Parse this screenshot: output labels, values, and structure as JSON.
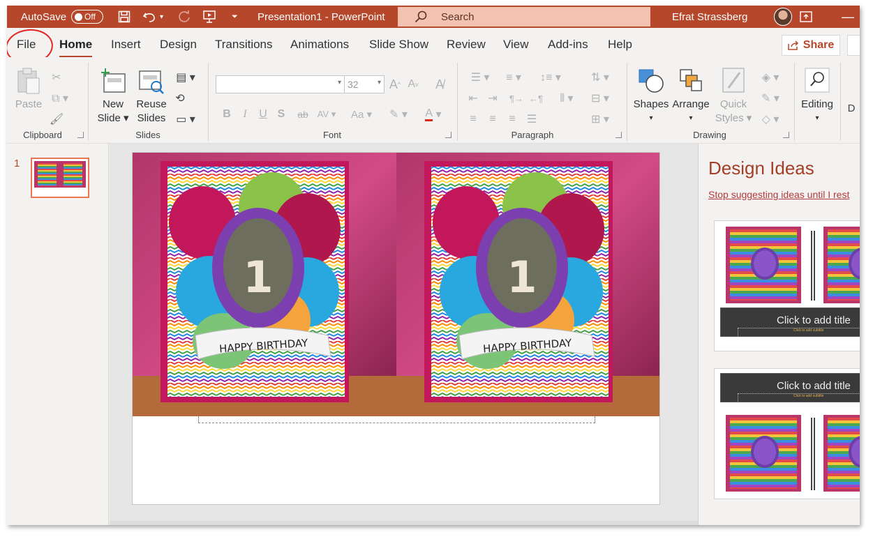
{
  "titlebar": {
    "autosave_label": "AutoSave",
    "autosave_state": "Off",
    "doc_title": "Presentation1 - PowerPoint",
    "search_placeholder": "Search",
    "user_name": "Efrat Strassberg"
  },
  "tabs": [
    "File",
    "Home",
    "Insert",
    "Design",
    "Transitions",
    "Animations",
    "Slide Show",
    "Review",
    "View",
    "Add-ins",
    "Help"
  ],
  "active_tab": "Home",
  "share_label": "Share",
  "ribbon": {
    "clipboard": {
      "label": "Clipboard",
      "paste": "Paste"
    },
    "slides": {
      "label": "Slides",
      "new_slide_1": "New",
      "new_slide_2": "Slide",
      "reuse_1": "Reuse",
      "reuse_2": "Slides"
    },
    "font": {
      "label": "Font",
      "size": "32"
    },
    "paragraph": {
      "label": "Paragraph"
    },
    "drawing": {
      "label": "Drawing",
      "shapes": "Shapes",
      "arrange": "Arrange",
      "quick_styles_1": "Quick",
      "quick_styles_2": "Styles"
    },
    "editing": {
      "label": "Editing"
    }
  },
  "thumbnails": {
    "slide_number": "1"
  },
  "slide": {
    "card_text": "HAPPY BIRTHDAY",
    "card_number": "1"
  },
  "design_ideas": {
    "title": "Design Ideas",
    "stop_link": "Stop suggesting ideas until I rest",
    "card_title": "Click to add title",
    "card_subtitle": "Click to add subtitle"
  },
  "colors": {
    "accent": "#b7472a",
    "ribbon_bg": "#f3f2f1"
  }
}
